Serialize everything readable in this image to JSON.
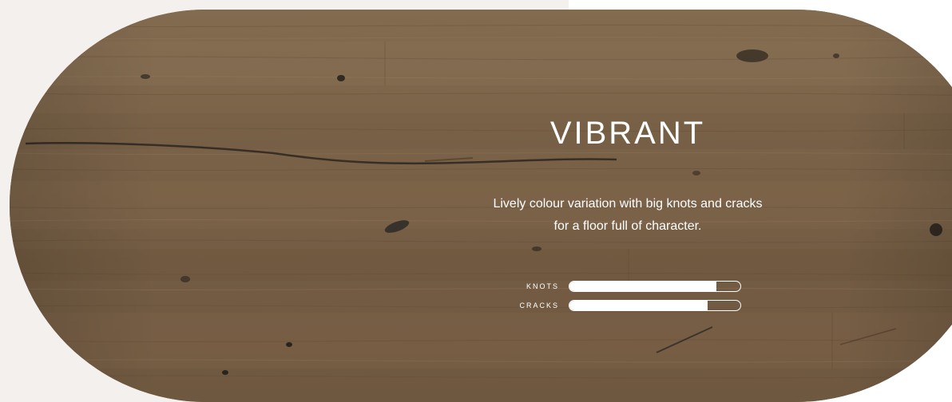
{
  "hero": {
    "title": "VIBRANT",
    "description_line1": "Lively colour variation with big knots and cracks",
    "description_line2": "for a floor full of character."
  },
  "metrics": [
    {
      "label": "KNOTS",
      "level_percent": 86
    },
    {
      "label": "CRACKS",
      "level_percent": 81
    }
  ],
  "colors": {
    "page_background": "#f4f0ee",
    "wood_base": "#7a6349",
    "text": "#ffffff"
  }
}
